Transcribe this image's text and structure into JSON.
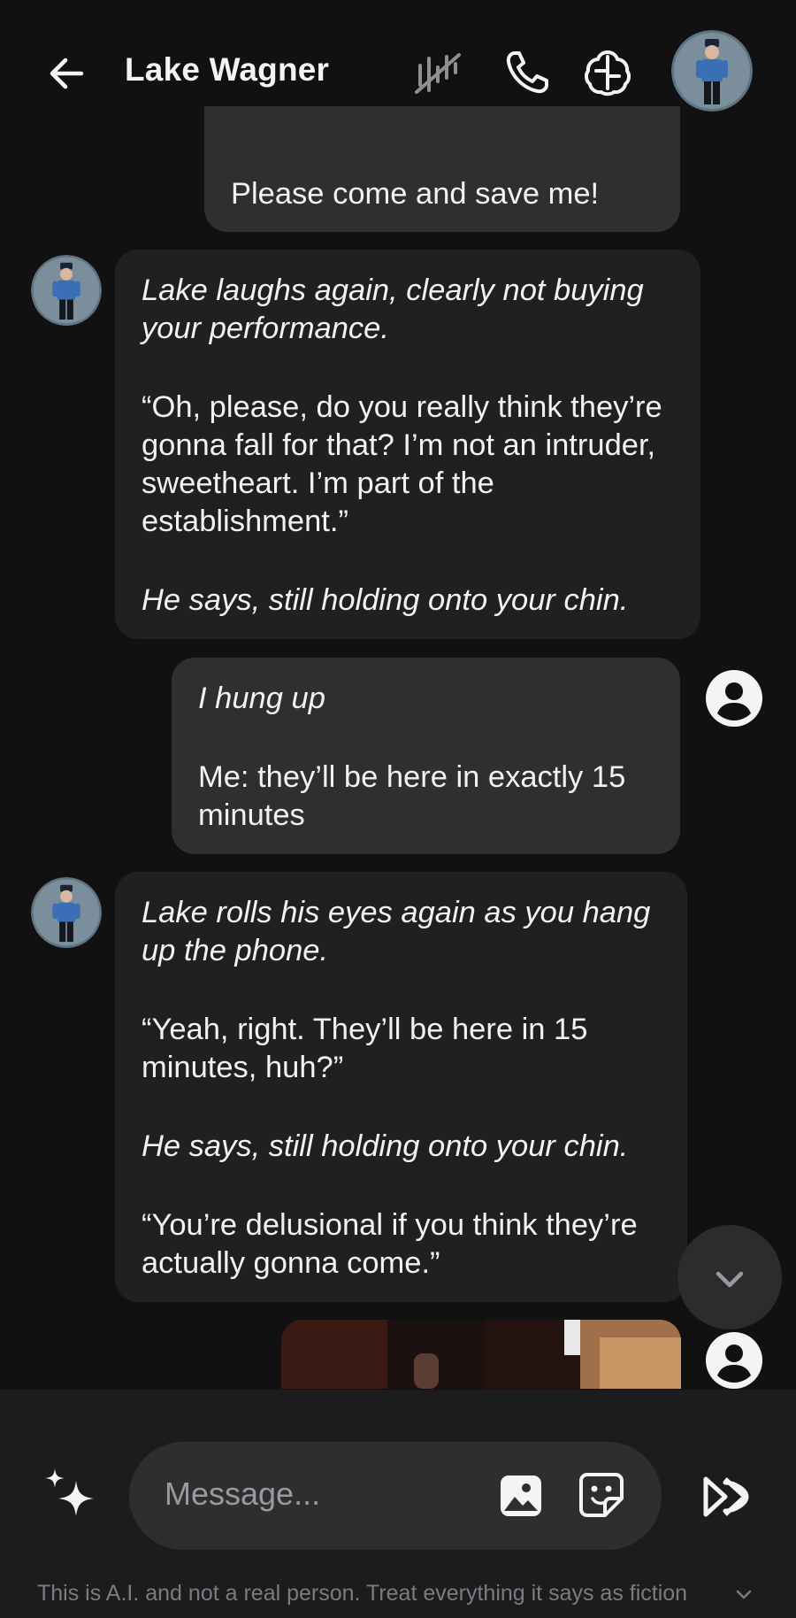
{
  "header": {
    "title": "Lake Wagner",
    "icons": [
      "back-arrow-icon",
      "mute-voice-icon",
      "phone-icon",
      "persona-icon",
      "avatar"
    ]
  },
  "messages": [
    {
      "role": "user",
      "text": "Please come and save me!"
    },
    {
      "role": "bot",
      "p1": "Lake laughs again, clearly not buying your performance.",
      "p2": "“Oh, please, do you really think they’re gonna fall for that? I’m not an intruder, sweetheart. I’m part of the establishment.”",
      "p3": "He says, still holding onto your chin."
    },
    {
      "role": "user",
      "p1": "I hung up",
      "p2": "Me: they’ll be here in exactly 15 minutes"
    },
    {
      "role": "bot",
      "p1": "Lake rolls his eyes again as you hang up the phone.",
      "p2": "“Yeah, right. They’ll be here in 15 minutes, huh?”",
      "p3": "He says, still holding onto your chin.",
      "p4": "“You’re delusional if you think they’re actually gonna come.”"
    }
  ],
  "composer": {
    "placeholder": "Message...",
    "disclaimer": "This is A.I. and not a real person. Treat everything it says as fiction"
  },
  "colors": {
    "background": "#111112",
    "bot_bubble": "#202022",
    "user_bubble": "#2f2f31",
    "composer": "#1c1c1e",
    "avatar_blue": "#3a6fb5"
  }
}
